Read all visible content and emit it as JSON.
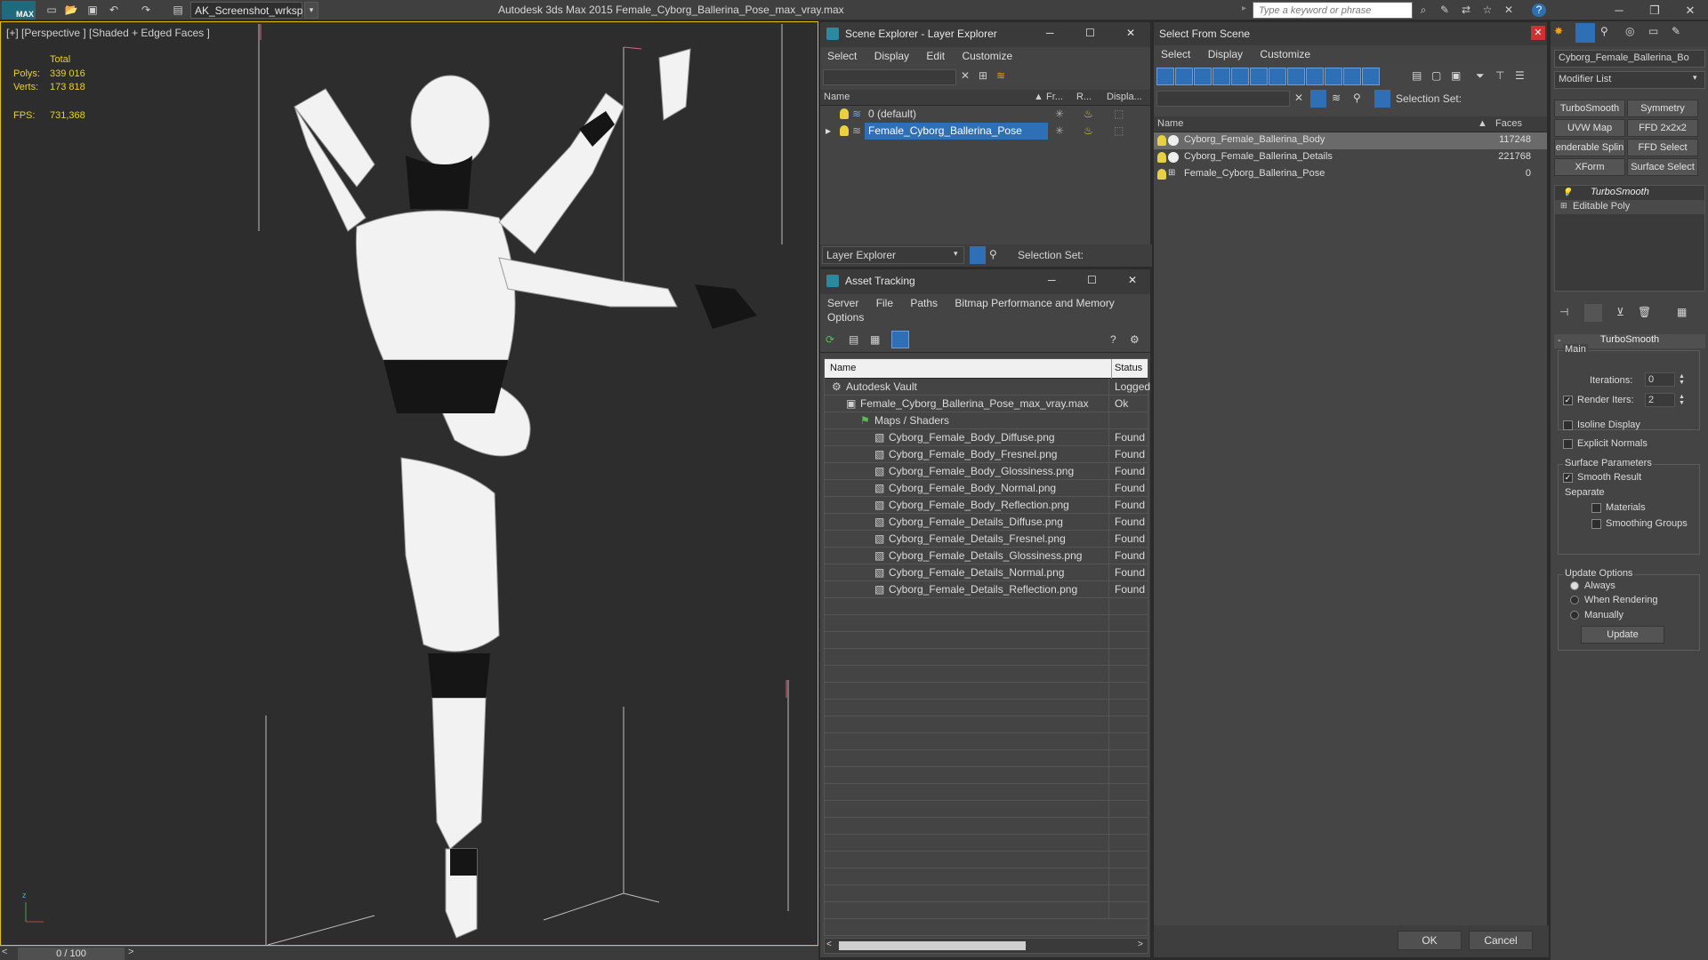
{
  "app": {
    "title": "Autodesk 3ds Max  2015    Female_Cyborg_Ballerina_Pose_max_vray.max",
    "logo": "MAX",
    "workspace": "AK_Screenshot_wrksp",
    "search_placeholder": "Type a keyword or phrase"
  },
  "viewport": {
    "label": "[+] [Perspective ] [Shaded + Edged Faces ]",
    "stats_header": "Total",
    "polys_label": "Polys:",
    "polys_value": "339 016",
    "verts_label": "Verts:",
    "verts_value": "173 818",
    "fps_label": "FPS:",
    "fps_value": "731,368",
    "timeline": "0 / 100"
  },
  "scene_explorer": {
    "title": "Scene Explorer - Layer Explorer",
    "menu": [
      "Select",
      "Display",
      "Edit",
      "Customize"
    ],
    "columns": [
      "Name",
      "Fr...",
      "R...",
      "Displa..."
    ],
    "rows": [
      {
        "name": "0 (default)"
      },
      {
        "name": "Female_Cyborg_Ballerina_Pose"
      }
    ],
    "footer_dropdown": "Layer Explorer",
    "footer_selection": "Selection Set:"
  },
  "asset_tracking": {
    "title": "Asset Tracking",
    "menu": [
      "Server",
      "File",
      "Paths",
      "Bitmap Performance and Memory"
    ],
    "menu2": "Options",
    "columns": [
      "Name",
      "Status"
    ],
    "rows": [
      {
        "name": "Autodesk Vault",
        "status": "Logged",
        "indent": 0
      },
      {
        "name": "Female_Cyborg_Ballerina_Pose_max_vray.max",
        "status": "Ok",
        "indent": 1
      },
      {
        "name": "Maps / Shaders",
        "status": "",
        "indent": 2
      },
      {
        "name": "Cyborg_Female_Body_Diffuse.png",
        "status": "Found",
        "indent": 3
      },
      {
        "name": "Cyborg_Female_Body_Fresnel.png",
        "status": "Found",
        "indent": 3
      },
      {
        "name": "Cyborg_Female_Body_Glossiness.png",
        "status": "Found",
        "indent": 3
      },
      {
        "name": "Cyborg_Female_Body_Normal.png",
        "status": "Found",
        "indent": 3
      },
      {
        "name": "Cyborg_Female_Body_Reflection.png",
        "status": "Found",
        "indent": 3
      },
      {
        "name": "Cyborg_Female_Details_Diffuse.png",
        "status": "Found",
        "indent": 3
      },
      {
        "name": "Cyborg_Female_Details_Fresnel.png",
        "status": "Found",
        "indent": 3
      },
      {
        "name": "Cyborg_Female_Details_Glossiness.png",
        "status": "Found",
        "indent": 3
      },
      {
        "name": "Cyborg_Female_Details_Normal.png",
        "status": "Found",
        "indent": 3
      },
      {
        "name": "Cyborg_Female_Details_Reflection.png",
        "status": "Found",
        "indent": 3
      }
    ]
  },
  "select_from_scene": {
    "title": "Select From Scene",
    "menu": [
      "Select",
      "Display",
      "Customize"
    ],
    "selection_set": "Selection Set:",
    "columns": [
      "Name",
      "Faces"
    ],
    "rows": [
      {
        "name": "Cyborg_Female_Ballerina_Body",
        "faces": "117248"
      },
      {
        "name": "Cyborg_Female_Ballerina_Details",
        "faces": "221768"
      },
      {
        "name": "Female_Cyborg_Ballerina_Pose",
        "faces": "0"
      }
    ],
    "ok": "OK",
    "cancel": "Cancel"
  },
  "modify_panel": {
    "object_name": "Cyborg_Female_Ballerina_Bo",
    "modifier_list": "Modifier List",
    "buttons": [
      "TurboSmooth",
      "Symmetry",
      "UVW Map",
      "FFD 2x2x2",
      "enderable Splin",
      "FFD Select",
      "XForm",
      "Surface Select"
    ],
    "stack": [
      "TurboSmooth",
      "Editable Poly"
    ],
    "rollout_title": "TurboSmooth",
    "main_label": "Main",
    "iterations_label": "Iterations:",
    "iterations_value": "0",
    "render_iters_label": "Render Iters:",
    "render_iters_value": "2",
    "isoline": "Isoline Display",
    "explicit_normals": "Explicit Normals",
    "surface_params": "Surface Parameters",
    "smooth_result": "Smooth Result",
    "separate": "Separate",
    "materials": "Materials",
    "smoothing_groups": "Smoothing Groups",
    "update_options": "Update Options",
    "always": "Always",
    "when_rendering": "When Rendering",
    "manually": "Manually",
    "update": "Update"
  }
}
